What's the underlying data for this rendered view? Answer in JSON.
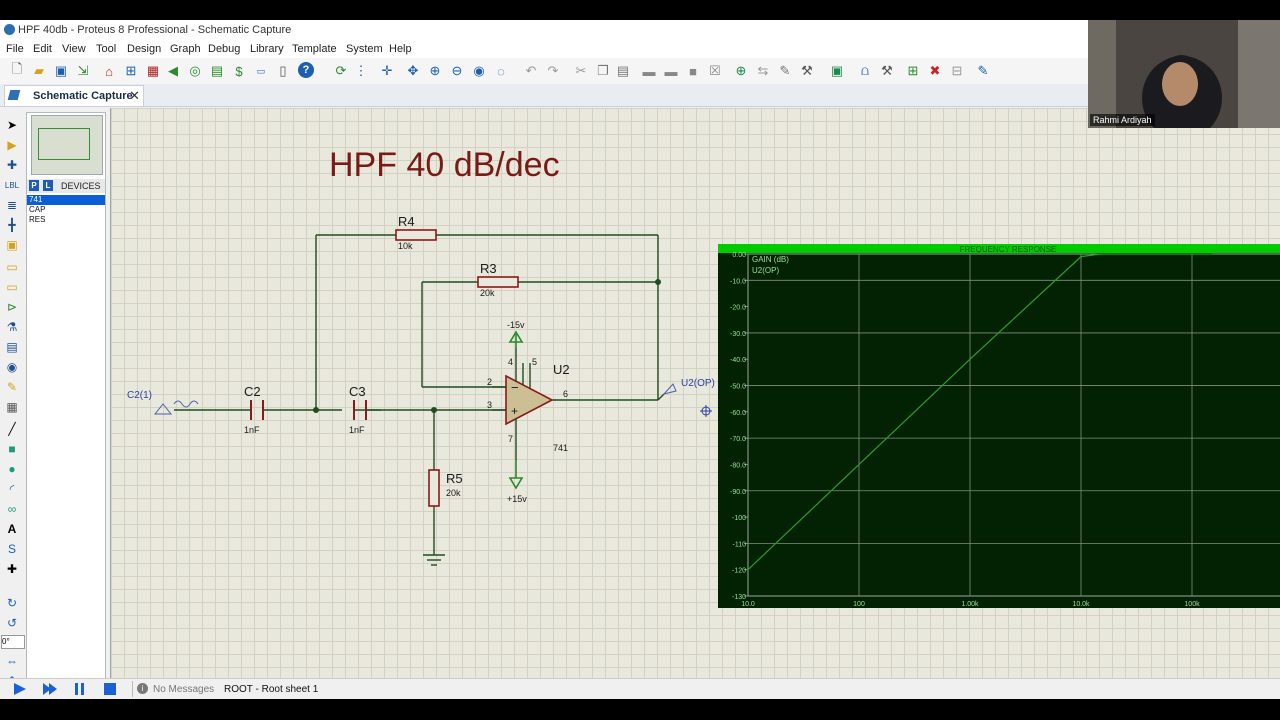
{
  "window": {
    "title": "HPF 40db - Proteus 8 Professional - Schematic Capture"
  },
  "menu": [
    "File",
    "Edit",
    "View",
    "Tool",
    "Design",
    "Graph",
    "Debug",
    "Library",
    "Template",
    "System",
    "Help"
  ],
  "tab": {
    "label": "Schematic Capture",
    "close_glyph": "✕"
  },
  "devices": {
    "p_button": "P",
    "l_button": "L",
    "header": "DEVICES",
    "items": [
      "741",
      "CAP",
      "RES"
    ],
    "selected_index": 0
  },
  "left_rotation_field": "0°",
  "schematic": {
    "heading": "HPF 40 dB/dec",
    "source_label": "C2(1)",
    "output_label": "U2(OP)",
    "components": {
      "C2": {
        "ref": "C2",
        "value": "1nF"
      },
      "C3": {
        "ref": "C3",
        "value": "1nF"
      },
      "R3": {
        "ref": "R3",
        "value": "20k"
      },
      "R4": {
        "ref": "R4",
        "value": "10k"
      },
      "R5": {
        "ref": "R5",
        "value": "20k"
      },
      "U2": {
        "ref": "U2",
        "value": "741"
      }
    },
    "pins": {
      "inv": "2",
      "noninv": "3",
      "out": "6",
      "vplus": "4",
      "vminus": "7",
      "offset": "5"
    },
    "rails": {
      "top": "-15v",
      "bottom": "+15v"
    }
  },
  "graph": {
    "title": "FREQUENCY RESPONSE",
    "background": "#032203",
    "title_bar_color": "#00cc00",
    "trace_color": "#2e9c2e"
  },
  "chart_data": {
    "type": "line",
    "title": "FREQUENCY RESPONSE",
    "ylabel": "GAIN (dB)",
    "x_scale": "log",
    "xlim": [
      10,
      100000
    ],
    "ylim": [
      -130,
      0
    ],
    "x_tick_labels": [
      "10.0",
      "100",
      "1.00k",
      "10.0k",
      "100k"
    ],
    "y_tick_labels": [
      "0.00",
      "-10.0",
      "-20.0",
      "-30.0",
      "-40.0",
      "-50.0",
      "-60.0",
      "-70.0",
      "-80.0",
      "-90.0",
      "-100",
      "-110",
      "-120",
      "-130"
    ],
    "series": [
      {
        "name": "U2(OP)",
        "x": [
          10,
          100,
          1000,
          10000,
          15000,
          20000,
          100000,
          150000
        ],
        "y": [
          -120,
          -80,
          -40,
          -1,
          0,
          0,
          0,
          0
        ]
      }
    ],
    "grid": true
  },
  "statusbar": {
    "messages": "No Messages",
    "sheet": "ROOT - Root sheet 1"
  },
  "webcam": {
    "name": "Rahmi Ardiyah"
  }
}
